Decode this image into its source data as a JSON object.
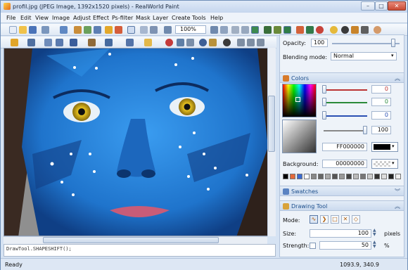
{
  "window": {
    "title": "profil.jpg (JPEG Image, 1392x1520 pixels) - RealWorld Paint",
    "min": "–",
    "max": "□",
    "close": "✕"
  },
  "menu": [
    "File",
    "Edit",
    "View",
    "Image",
    "Adjust",
    "Effect",
    "Ps-filter",
    "Mask",
    "Layer",
    "Create",
    "Tools",
    "Help"
  ],
  "toolbar": {
    "zoom": "100%"
  },
  "script_line": "DrawTool.SHAPESHIFT();",
  "status": {
    "text": "Ready",
    "coords": "1093.9, 340.9"
  },
  "panel": {
    "opacity_label": "Opacity:",
    "opacity_value": "100",
    "blend_label": "Blending mode:",
    "blend_value": "Normal",
    "colors_title": "Colors",
    "r_value": "0",
    "g_value": "0",
    "b_value": "0",
    "alpha_value": "100",
    "hex_value": "FF000000",
    "bg_label": "Background:",
    "bg_value": "00000000",
    "swatches_title": "Swatches",
    "drawing_title": "Drawing Tool",
    "mode_label": "Mode:",
    "size_label": "Size:",
    "size_value": "100",
    "size_unit": "pixels",
    "strength_label": "Strength:",
    "strength_value": "50",
    "strength_unit": "%"
  },
  "colors": {
    "accent": "#1d4f8c",
    "face": "#2a8be0"
  }
}
